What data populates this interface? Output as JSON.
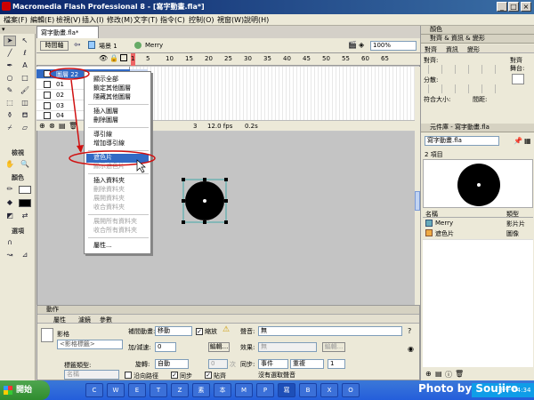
{
  "app": {
    "title": "Macromedia Flash Professional 8 - [寫字動畫.fla*]",
    "accent": "#0a246a",
    "window_buttons": [
      "_",
      "□",
      "×"
    ]
  },
  "menubar": [
    "檔案(F)",
    "編輯(E)",
    "檢視(V)",
    "插入(I)",
    "修改(M)",
    "文字(T)",
    "指令(C)",
    "控制(O)",
    "視窗(W)",
    "說明(H)"
  ],
  "tools": {
    "section_view": "檢視",
    "section_color": "顏色",
    "section_options": "選項",
    "icons": [
      "arrow-icon",
      "subselect-icon",
      "line-icon",
      "lasso-icon",
      "pen-icon",
      "text-icon",
      "oval-icon",
      "rect-icon",
      "pencil-icon",
      "brush-icon",
      "free-transform-icon",
      "fill-transform-icon",
      "ink-bottle-icon",
      "paint-bucket-icon",
      "eyedropper-icon",
      "eraser-icon"
    ]
  },
  "document": {
    "tab": "寫字動畫.fla*",
    "timeline_button": "時間軸",
    "scene": "場景 1",
    "symbol": "Merry",
    "zoom": "100%"
  },
  "timeline": {
    "frame_numbers": [
      "1",
      "5",
      "10",
      "15",
      "20",
      "25",
      "30",
      "35",
      "40",
      "45",
      "50",
      "55",
      "60",
      "65"
    ],
    "layers": [
      "圖層 22",
      "01",
      "02",
      "03",
      "04"
    ],
    "current_frame": "3",
    "fps": "12.0 fps",
    "time": "0.2s"
  },
  "context_menu": {
    "items": [
      {
        "label": "顯示全部",
        "disabled": false
      },
      {
        "label": "鎖定其他圖層",
        "disabled": false
      },
      {
        "label": "隱藏其他圖層",
        "disabled": false
      },
      {
        "label": "插入圖層",
        "disabled": false
      },
      {
        "label": "刪除圖層",
        "disabled": false
      },
      {
        "label": "導引線",
        "disabled": false
      },
      {
        "label": "增加導引線",
        "disabled": false
      },
      {
        "label": "遮色片",
        "disabled": false,
        "highlighted": true
      },
      {
        "label": "顯示遮色片",
        "disabled": true
      },
      {
        "label": "插入資料夾",
        "disabled": false
      },
      {
        "label": "刪除資料夾",
        "disabled": true
      },
      {
        "label": "展開資料夾",
        "disabled": true
      },
      {
        "label": "收合資料夾",
        "disabled": true
      },
      {
        "label": "展開所有資料夾",
        "disabled": true
      },
      {
        "label": "收合所有資料夾",
        "disabled": true
      },
      {
        "label": "屬性...",
        "disabled": false
      }
    ]
  },
  "properties": {
    "header": "動作",
    "tabs": [
      "屬性",
      "濾鏡",
      "參數"
    ],
    "type": "影格",
    "frame_label_placeholder": "<影格標籤>",
    "label_type": "標籤類型:",
    "label_type_value": "名稱",
    "tween_label": "補間動畫:",
    "tween_value": "移動",
    "scale_label": "縮放",
    "ease_label": "加/減速:",
    "ease_value": "0",
    "edit_button": "編輯...",
    "rotate_label": "旋轉:",
    "rotate_value": "自動",
    "times_value": "0",
    "times_unit": "次",
    "orient_label": "沿向路徑",
    "sync_label": "同步",
    "snap_label": "貼齊",
    "sound_label": "聲音:",
    "sound_value": "無",
    "effect_label": "效果:",
    "effect_value": "無",
    "effect_edit": "編輯...",
    "sync2_label": "同步:",
    "sync2_value": "事件",
    "repeat_value": "重複",
    "repeat_count": "1",
    "no_sound": "沒有選取聲音"
  },
  "right_panel": {
    "color_header": "顏色",
    "align_header": "對齊 & 資訊 & 變形",
    "align_tabs": [
      "對齊",
      "資訊",
      "變形"
    ],
    "align_label": "對齊:",
    "distribute_label": "分散:",
    "match_label": "符合大小:",
    "space_label": "間距:",
    "to_stage_label": "對齊\n舞台:",
    "to_stage_1": "對齊",
    "to_stage_2": "舞台:",
    "library_header": "元件庫 - 寫字動畫.fla",
    "library_doc": "寫字動畫.fla",
    "item_count": "2 項目",
    "col_name": "名稱",
    "col_type": "類型",
    "items": [
      {
        "name": "Merry",
        "type": "影片片",
        "icon": "movieclip-icon"
      },
      {
        "name": "遮色片",
        "type": "圖像",
        "icon": "graphic-icon"
      }
    ]
  },
  "taskbar": {
    "start": "開始",
    "items": [
      "C",
      "W",
      "E",
      "T",
      "Z",
      "素",
      "本",
      "M",
      "P",
      "寫",
      "B",
      "X",
      "O"
    ],
    "time": "下午 04:34"
  },
  "watermark": "Photo by Soujiro"
}
